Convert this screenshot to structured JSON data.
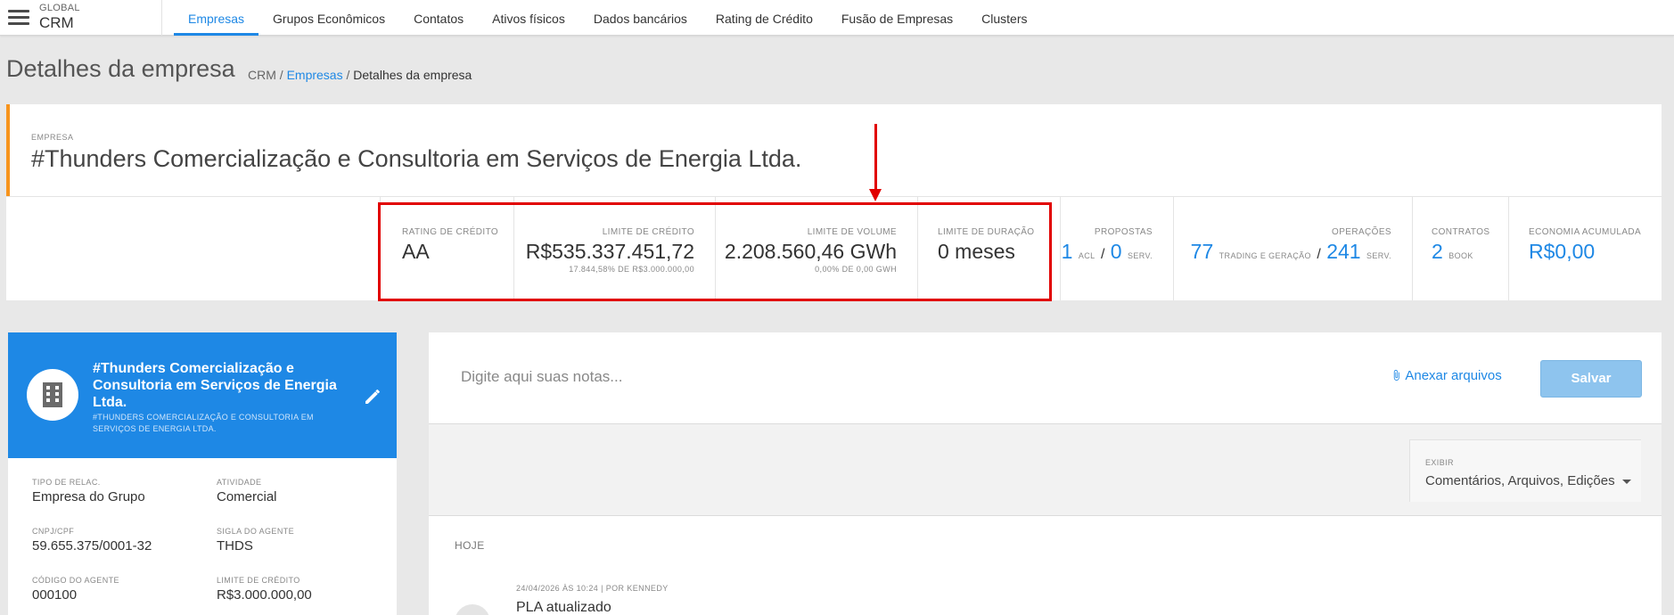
{
  "nav": {
    "brand_small": "GLOBAL",
    "brand_big": "CRM",
    "tabs": [
      "Empresas",
      "Grupos Econômicos",
      "Contatos",
      "Ativos físicos",
      "Dados bancários",
      "Rating de Crédito",
      "Fusão de Empresas",
      "Clusters"
    ],
    "active_tab": "Empresas"
  },
  "page": {
    "title": "Detalhes da empresa",
    "breadcrumb": {
      "root": "CRM",
      "sep": " / ",
      "link": "Empresas",
      "current": "Detalhes da empresa"
    }
  },
  "company": {
    "label": "EMPRESA",
    "name": "#Thunders Comercialização e Consultoria em Serviços de Energia Ltda."
  },
  "stats": {
    "rating": {
      "label": "RATING DE CRÉDITO",
      "value": "AA"
    },
    "credit_limit": {
      "label": "LIMITE DE CRÉDITO",
      "value": "R$535.337.451,72",
      "sub": "17.844,58% DE R$3.000.000,00"
    },
    "volume_limit": {
      "label": "LIMITE DE VOLUME",
      "value": "2.208.560,46 GWh",
      "sub": "0,00% DE 0,00 GWH"
    },
    "duration_limit": {
      "label": "LIMITE DE DURAÇÃO",
      "value": "0 meses"
    },
    "proposals": {
      "label": "PROPOSTAS",
      "acl_count": "1",
      "acl_label": "ACL",
      "sep": "/",
      "serv_count": "0",
      "serv_label": "SERV."
    },
    "operations": {
      "label": "OPERAÇÕES",
      "trading_count": "77",
      "trading_label": "TRADING E GERAÇÃO",
      "sep": "/",
      "serv_count": "241",
      "serv_label": "SERV."
    },
    "contracts": {
      "label": "CONTRATOS",
      "count": "2",
      "unit": "BOOK"
    },
    "savings": {
      "label": "ECONOMIA ACUMULADA",
      "value": "R$0,00"
    }
  },
  "profile": {
    "name": "#Thunders Comercialização e Consultoria em Serviços de Energia Ltda.",
    "subtitle": "#THUNDERS COMERCIALIZAÇÃO E CONSULTORIA EM SERVIÇOS DE ENERGIA LTDA.",
    "fields": {
      "rel_type": {
        "label": "TIPO DE RELAC.",
        "value": "Empresa do Grupo"
      },
      "activity": {
        "label": "ATIVIDADE",
        "value": "Comercial"
      },
      "cnpj": {
        "label": "CNPJ/CPF",
        "value": "59.655.375/0001-32"
      },
      "agent_code": {
        "label": "SIGLA DO AGENTE",
        "value": "THDS"
      },
      "agent_number": {
        "label": "CÓDIGO DO AGENTE",
        "value": "000100"
      },
      "credit_limit": {
        "label": "LIMITE DE CRÉDITO",
        "value": "R$3.000.000,00"
      }
    }
  },
  "notes": {
    "placeholder": "Digite aqui suas notas...",
    "attach_label": "Anexar arquivos",
    "save_label": "Salvar",
    "filter_label": "EXIBIR",
    "filter_value": "Comentários, Arquivos, Edições",
    "day_label": "HOJE",
    "entry_meta": "24/04/2026 ÀS 10:24 | POR KENNEDY",
    "entry_title": "PLA atualizado"
  },
  "colors": {
    "accent": "#1e88e5",
    "orange": "#f7941d",
    "highlight": "#e10000"
  }
}
